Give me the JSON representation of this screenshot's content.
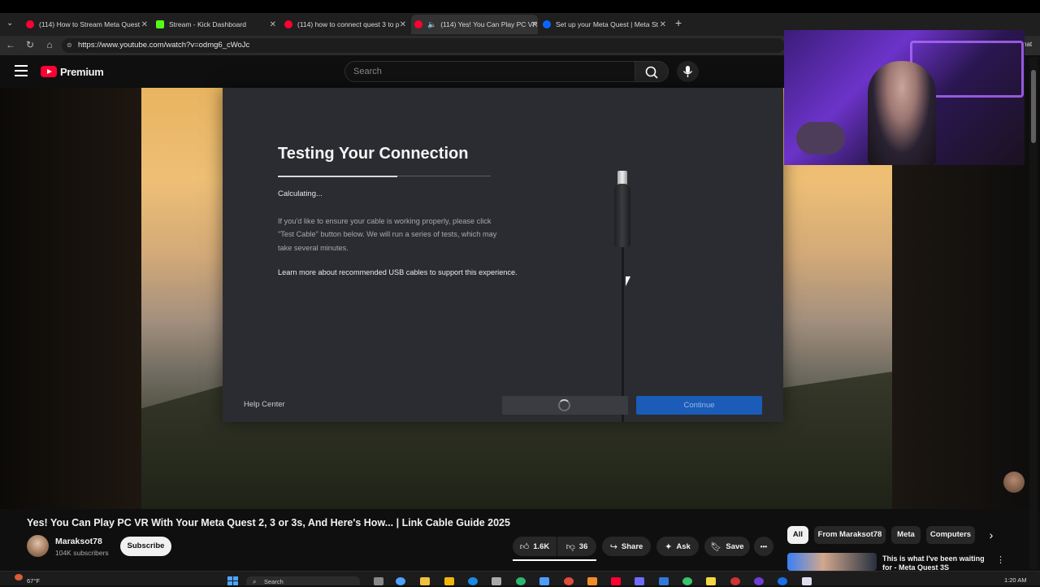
{
  "browser": {
    "tabs": [
      {
        "label": "(114) How to Stream Meta Quest",
        "fav_color": "#ff0033"
      },
      {
        "label": "Stream - Kick Dashboard",
        "fav_color": "#53fc18"
      },
      {
        "label": "(114) how to connect quest 3 to p",
        "fav_color": "#ff0033"
      },
      {
        "label": "(114) Yes! You Can Play PC VR",
        "fav_color": "#ff0033"
      },
      {
        "label": "Set up your Meta Quest | Meta St",
        "fav_color": "#0866ff"
      }
    ],
    "new_tab": "+",
    "url": "https://www.youtube.com/watch?v=odmg6_cWoJc",
    "side_text": "hat"
  },
  "youtube": {
    "logo_text": "Premium",
    "search_placeholder": "Search"
  },
  "dialog": {
    "title": "Testing Your Connection",
    "progress": 0.56,
    "status": "Calculating...",
    "body": "If you'd like to ensure your cable is working properly, please click \"Test Cable\" button below. We will run a series of tests, which may take several minutes.",
    "link": "Learn more about recommended USB cables to support this experience.",
    "help_center": "Help Center",
    "continue": "Continue"
  },
  "video": {
    "title": "Yes! You Can Play PC VR With Your Meta Quest 2, 3 or 3s, And Here's How... | Link Cable Guide 2025",
    "channel": "Maraksot78",
    "subscribers": "104K subscribers",
    "subscribe": "Subscribe",
    "likes": "1.6K",
    "dislikes": "36",
    "share": "Share",
    "ask": "Ask",
    "save": "Save",
    "more": "•••"
  },
  "chips": [
    "All",
    "From Maraksot78",
    "Meta",
    "Computers"
  ],
  "recommended": {
    "title": "This is what I've been waiting for - Meta Quest 3S",
    "more": "⋮"
  },
  "taskbar": {
    "weather": "67°F",
    "search": "Search",
    "clock": "1:20 AM"
  }
}
